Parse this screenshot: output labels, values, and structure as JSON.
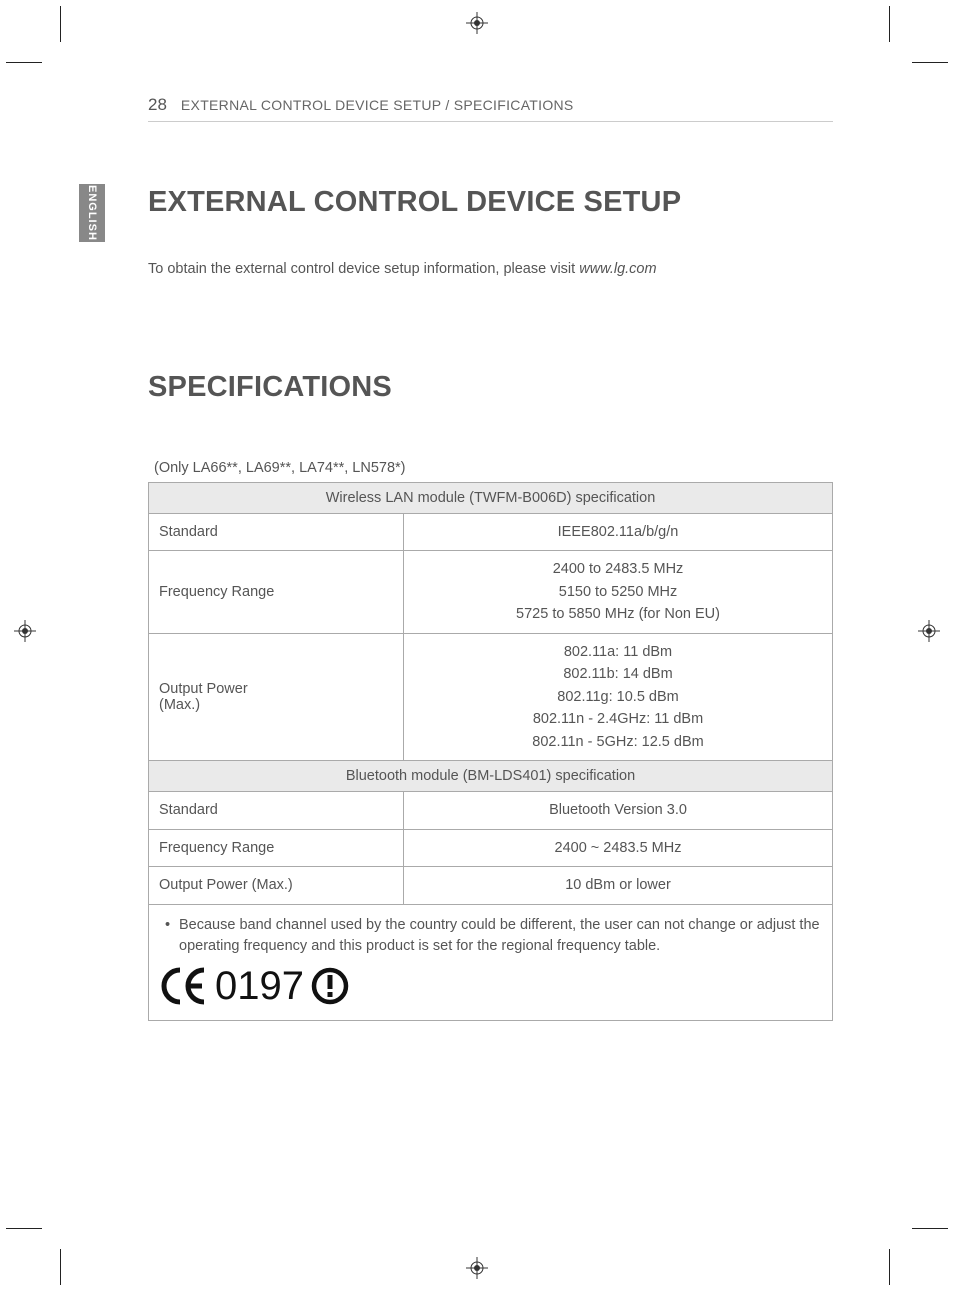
{
  "lang_tab": "ENGLISH",
  "page_number": "28",
  "header_title": "EXTERNAL CONTROL DEVICE SETUP / SPECIFICATIONS",
  "heading1": "EXTERNAL CONTROL DEVICE SETUP",
  "intro_prefix": "To obtain the external control device setup information, please visit ",
  "intro_link": "www.lg.com",
  "heading2": "SPECIFICATIONS",
  "models_note": "(Only LA66**, LA69**, LA74**, LN578*)",
  "spec_table": {
    "wlan_header": "Wireless LAN module (TWFM-B006D) specification",
    "rows_wlan": [
      {
        "label": "Standard",
        "value": "IEEE802.11a/b/g/n"
      },
      {
        "label": "Frequency Range",
        "value": "2400 to 2483.5 MHz\n5150 to 5250 MHz\n5725 to 5850 MHz (for Non EU)"
      },
      {
        "label": "Output Power\n(Max.)",
        "value": "802.11a: 11 dBm\n802.11b: 14 dBm\n802.11g: 10.5 dBm\n802.11n - 2.4GHz: 11 dBm\n802.11n - 5GHz: 12.5 dBm"
      }
    ],
    "bt_header": "Bluetooth module (BM-LDS401) specification",
    "rows_bt": [
      {
        "label": "Standard",
        "value": "Bluetooth Version 3.0"
      },
      {
        "label": "Frequency Range",
        "value": "2400 ~ 2483.5 MHz"
      },
      {
        "label": "Output Power (Max.)",
        "value": "10 dBm or lower"
      }
    ],
    "note": "Because band channel used by the country could be different, the user can not change or adjust the operating frequency and this product is set for the regional frequency table.",
    "ce_number": "0197"
  }
}
